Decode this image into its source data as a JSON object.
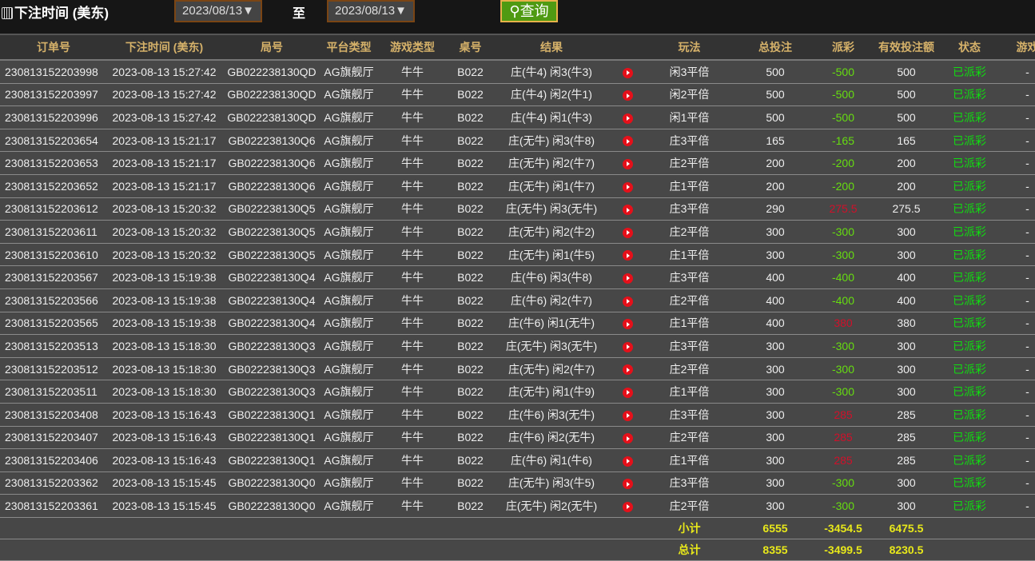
{
  "filter": {
    "label": "下注时间 (美东)",
    "from": "2023/08/13▼",
    "to_label": "至",
    "to": "2023/08/13▼",
    "query": "查询"
  },
  "columns": [
    "订单号",
    "下注时间 (美东)",
    "局号",
    "平台类型",
    "游戏类型",
    "桌号",
    "结果",
    "",
    "玩法",
    "总投注",
    "派彩",
    "有效投注额",
    "状态",
    "游戏"
  ],
  "rows": [
    [
      "230813152203998",
      "2023-08-13 15:27:42",
      "GB022238130QD",
      "AG旗舰厅",
      "牛牛",
      "B022",
      "庄(牛4) 闲3(牛3)",
      "闲3平倍",
      "500",
      "-500",
      "500",
      "已派彩",
      "-"
    ],
    [
      "230813152203997",
      "2023-08-13 15:27:42",
      "GB022238130QD",
      "AG旗舰厅",
      "牛牛",
      "B022",
      "庄(牛4) 闲2(牛1)",
      "闲2平倍",
      "500",
      "-500",
      "500",
      "已派彩",
      "-"
    ],
    [
      "230813152203996",
      "2023-08-13 15:27:42",
      "GB022238130QD",
      "AG旗舰厅",
      "牛牛",
      "B022",
      "庄(牛4) 闲1(牛3)",
      "闲1平倍",
      "500",
      "-500",
      "500",
      "已派彩",
      "-"
    ],
    [
      "230813152203654",
      "2023-08-13 15:21:17",
      "GB022238130Q6",
      "AG旗舰厅",
      "牛牛",
      "B022",
      "庄(无牛) 闲3(牛8)",
      "庄3平倍",
      "165",
      "-165",
      "165",
      "已派彩",
      "-"
    ],
    [
      "230813152203653",
      "2023-08-13 15:21:17",
      "GB022238130Q6",
      "AG旗舰厅",
      "牛牛",
      "B022",
      "庄(无牛) 闲2(牛7)",
      "庄2平倍",
      "200",
      "-200",
      "200",
      "已派彩",
      "-"
    ],
    [
      "230813152203652",
      "2023-08-13 15:21:17",
      "GB022238130Q6",
      "AG旗舰厅",
      "牛牛",
      "B022",
      "庄(无牛) 闲1(牛7)",
      "庄1平倍",
      "200",
      "-200",
      "200",
      "已派彩",
      "-"
    ],
    [
      "230813152203612",
      "2023-08-13 15:20:32",
      "GB022238130Q5",
      "AG旗舰厅",
      "牛牛",
      "B022",
      "庄(无牛) 闲3(无牛)",
      "庄3平倍",
      "290",
      "275.5",
      "275.5",
      "已派彩",
      "-"
    ],
    [
      "230813152203611",
      "2023-08-13 15:20:32",
      "GB022238130Q5",
      "AG旗舰厅",
      "牛牛",
      "B022",
      "庄(无牛) 闲2(牛2)",
      "庄2平倍",
      "300",
      "-300",
      "300",
      "已派彩",
      "-"
    ],
    [
      "230813152203610",
      "2023-08-13 15:20:32",
      "GB022238130Q5",
      "AG旗舰厅",
      "牛牛",
      "B022",
      "庄(无牛) 闲1(牛5)",
      "庄1平倍",
      "300",
      "-300",
      "300",
      "已派彩",
      "-"
    ],
    [
      "230813152203567",
      "2023-08-13 15:19:38",
      "GB022238130Q4",
      "AG旗舰厅",
      "牛牛",
      "B022",
      "庄(牛6) 闲3(牛8)",
      "庄3平倍",
      "400",
      "-400",
      "400",
      "已派彩",
      "-"
    ],
    [
      "230813152203566",
      "2023-08-13 15:19:38",
      "GB022238130Q4",
      "AG旗舰厅",
      "牛牛",
      "B022",
      "庄(牛6) 闲2(牛7)",
      "庄2平倍",
      "400",
      "-400",
      "400",
      "已派彩",
      "-"
    ],
    [
      "230813152203565",
      "2023-08-13 15:19:38",
      "GB022238130Q4",
      "AG旗舰厅",
      "牛牛",
      "B022",
      "庄(牛6) 闲1(无牛)",
      "庄1平倍",
      "400",
      "380",
      "380",
      "已派彩",
      "-"
    ],
    [
      "230813152203513",
      "2023-08-13 15:18:30",
      "GB022238130Q3",
      "AG旗舰厅",
      "牛牛",
      "B022",
      "庄(无牛) 闲3(无牛)",
      "庄3平倍",
      "300",
      "-300",
      "300",
      "已派彩",
      "-"
    ],
    [
      "230813152203512",
      "2023-08-13 15:18:30",
      "GB022238130Q3",
      "AG旗舰厅",
      "牛牛",
      "B022",
      "庄(无牛) 闲2(牛7)",
      "庄2平倍",
      "300",
      "-300",
      "300",
      "已派彩",
      "-"
    ],
    [
      "230813152203511",
      "2023-08-13 15:18:30",
      "GB022238130Q3",
      "AG旗舰厅",
      "牛牛",
      "B022",
      "庄(无牛) 闲1(牛9)",
      "庄1平倍",
      "300",
      "-300",
      "300",
      "已派彩",
      "-"
    ],
    [
      "230813152203408",
      "2023-08-13 15:16:43",
      "GB022238130Q1",
      "AG旗舰厅",
      "牛牛",
      "B022",
      "庄(牛6) 闲3(无牛)",
      "庄3平倍",
      "300",
      "285",
      "285",
      "已派彩",
      "-"
    ],
    [
      "230813152203407",
      "2023-08-13 15:16:43",
      "GB022238130Q1",
      "AG旗舰厅",
      "牛牛",
      "B022",
      "庄(牛6) 闲2(无牛)",
      "庄2平倍",
      "300",
      "285",
      "285",
      "已派彩",
      "-"
    ],
    [
      "230813152203406",
      "2023-08-13 15:16:43",
      "GB022238130Q1",
      "AG旗舰厅",
      "牛牛",
      "B022",
      "庄(牛6) 闲1(牛6)",
      "庄1平倍",
      "300",
      "285",
      "285",
      "已派彩",
      "-"
    ],
    [
      "230813152203362",
      "2023-08-13 15:15:45",
      "GB022238130Q0",
      "AG旗舰厅",
      "牛牛",
      "B022",
      "庄(无牛) 闲3(牛5)",
      "庄3平倍",
      "300",
      "-300",
      "300",
      "已派彩",
      "-"
    ],
    [
      "230813152203361",
      "2023-08-13 15:15:45",
      "GB022238130Q0",
      "AG旗舰厅",
      "牛牛",
      "B022",
      "庄(无牛) 闲2(无牛)",
      "庄2平倍",
      "300",
      "-300",
      "300",
      "已派彩",
      "-"
    ]
  ],
  "subtotal": {
    "label": "小计",
    "total_bet": "6555",
    "payout": "-3454.5",
    "valid_bet": "6475.5"
  },
  "total": {
    "label": "总计",
    "total_bet": "8355",
    "payout": "-3499.5",
    "valid_bet": "8230.5"
  },
  "colors": {
    "negative": "#66dd10",
    "positive": "#d0102a",
    "status": "#10dd10",
    "header_text": "#d6b26a",
    "summary": "#e8e81a"
  }
}
